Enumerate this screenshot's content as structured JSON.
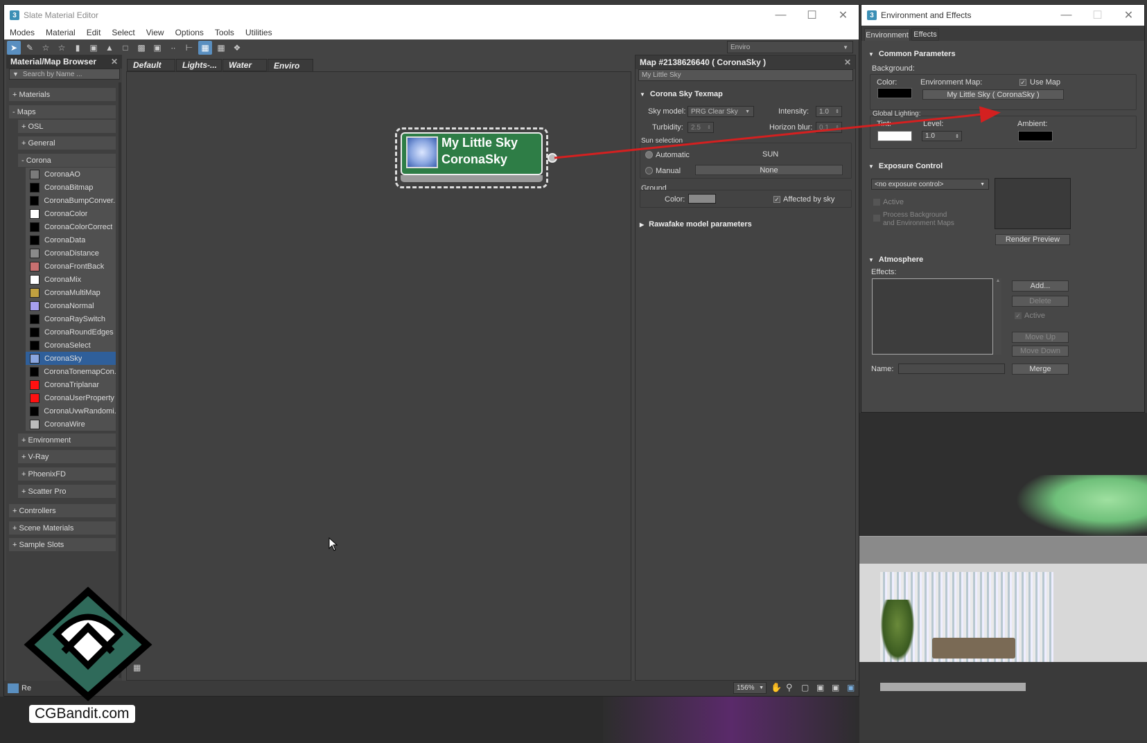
{
  "slate": {
    "title": "Slate Material Editor",
    "menu": [
      "Modes",
      "Material",
      "Edit",
      "Select",
      "View",
      "Options",
      "Tools",
      "Utilities"
    ],
    "view_dropdown": "Enviro",
    "browser": {
      "header": "Material/Map Browser",
      "search_placeholder": "Search by Name ...",
      "materials": "+ Materials",
      "maps": "- Maps",
      "osl": "+ OSL",
      "general": "+ General",
      "corona": "- Corona",
      "items": [
        {
          "label": "CoronaAO",
          "color": "#7a7a7a"
        },
        {
          "label": "CoronaBitmap",
          "color": "#000000"
        },
        {
          "label": "CoronaBumpConver...",
          "color": "#000000"
        },
        {
          "label": "CoronaColor",
          "color": "#ffffff"
        },
        {
          "label": "CoronaColorCorrect",
          "color": "#000000"
        },
        {
          "label": "CoronaData",
          "color": "#000000"
        },
        {
          "label": "CoronaDistance",
          "color": "#8a8a8a"
        },
        {
          "label": "CoronaFrontBack",
          "color": "#c87070"
        },
        {
          "label": "CoronaMix",
          "color": "#ffffff"
        },
        {
          "label": "CoronaMultiMap",
          "color": "#c0a040"
        },
        {
          "label": "CoronaNormal",
          "color": "#a8a0f0"
        },
        {
          "label": "CoronaRaySwitch",
          "color": "#000000"
        },
        {
          "label": "CoronaRoundEdges",
          "color": "#000000"
        },
        {
          "label": "CoronaSelect",
          "color": "#000000"
        },
        {
          "label": "CoronaSky",
          "color": "#8aa6e0"
        },
        {
          "label": "CoronaTonemapCon...",
          "color": "#000000"
        },
        {
          "label": "CoronaTriplanar",
          "color": "#ff1010"
        },
        {
          "label": "CoronaUserProperty",
          "color": "#ff1010"
        },
        {
          "label": "CoronaUvwRandomi...",
          "color": "#000000"
        },
        {
          "label": "CoronaWire",
          "color": "#bbbbbb"
        }
      ],
      "environment": "+ Environment",
      "vray": "+ V-Ray",
      "phoenix": "+ PhoenixFD",
      "scatter": "+ Scatter Pro",
      "controllers": "+ Controllers",
      "scene_materials": "+ Scene Materials",
      "sample_slots": "+ Sample Slots"
    },
    "tabs": [
      "Default",
      "Lights-...",
      "Water",
      "Enviro"
    ],
    "node": {
      "line1": "My Little Sky",
      "line2": "CoronaSky"
    },
    "params": {
      "title": "Map #2138626640  ( CoronaSky )",
      "name": "My Little Sky",
      "rollout_sky": "Corona Sky Texmap",
      "sky_model_label": "Sky model:",
      "sky_model": "PRG Clear Sky",
      "intensity_label": "Intensity:",
      "intensity": "1.0",
      "turbidity_label": "Turbidity:",
      "turbidity": "2.5",
      "horizon_label": "Horizon blur:",
      "horizon": "0.1",
      "sun_selection": "Sun selection",
      "automatic": "Automatic",
      "sun_name": "SUN",
      "manual": "Manual",
      "none": "None",
      "ground": "Ground",
      "color_label": "Color:",
      "affected": "Affected by sky",
      "rollout_rawfake": "Rawafake model parameters"
    },
    "zoom": "156%",
    "status_prefix": "Re"
  },
  "env": {
    "title": "Environment and Effects",
    "tabs": [
      "Environment",
      "Effects"
    ],
    "common": "Common Parameters",
    "background": "Background:",
    "color": "Color:",
    "env_map": "Environment Map:",
    "use_map": "Use Map",
    "map_button": "My Little Sky  ( CoronaSky )",
    "global_lighting": "Global Lighting:",
    "tint": "Tint:",
    "level": "Level:",
    "level_value": "1.0",
    "ambient": "Ambient:",
    "exposure": "Exposure Control",
    "exposure_select": "<no exposure control>",
    "active": "Active",
    "process_bg": "Process Background",
    "process_bg2": "and Environment Maps",
    "render_preview": "Render Preview",
    "atmosphere": "Atmosphere",
    "effects": "Effects:",
    "add": "Add...",
    "delete": "Delete",
    "atm_active": "Active",
    "move_up": "Move Up",
    "move_down": "Move Down",
    "name": "Name:",
    "merge": "Merge"
  },
  "watermark": "CGBandit.com",
  "colors": {
    "node_green": "#2e7d46",
    "arrow_red": "#d42020",
    "selection_blue": "#2f5f9a"
  }
}
